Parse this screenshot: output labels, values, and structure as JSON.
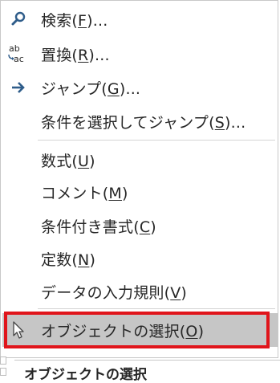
{
  "menu": {
    "items": [
      {
        "name": "find",
        "text": "検索(",
        "accel": "F",
        "tail": ")...",
        "icon": "search-icon"
      },
      {
        "name": "replace",
        "text": "置換(",
        "accel": "R",
        "tail": ")...",
        "icon": "replace-abc-icon",
        "icon_text_top": "ab",
        "icon_text_bottom": "ac"
      },
      {
        "name": "goto",
        "text": "ジャンプ(",
        "accel": "G",
        "tail": ")...",
        "icon": "arrow-right-icon"
      },
      {
        "name": "goto-special",
        "text": "条件を選択してジャンプ(",
        "accel": "S",
        "tail": ")..."
      },
      {
        "name": "formulas",
        "text": "数式(",
        "accel": "U",
        "tail": ")"
      },
      {
        "name": "comments",
        "text": "コメント(",
        "accel": "M",
        "tail": ")"
      },
      {
        "name": "conditional-formatting",
        "text": "条件付き書式(",
        "accel": "C",
        "tail": ")"
      },
      {
        "name": "constants",
        "text": "定数(",
        "accel": "N",
        "tail": ")"
      },
      {
        "name": "data-validation",
        "text": "データの入力規則(",
        "accel": "V",
        "tail": ")"
      },
      {
        "name": "select-objects",
        "text": "オブジェクトの選択(",
        "accel": "O",
        "tail": ")",
        "icon": "pointer-arrow-icon",
        "selected": true
      }
    ]
  },
  "tooltip": {
    "text": "オブジェクトの選択"
  },
  "colors": {
    "highlight_border": "#e0151b",
    "selected_background": "#c6c6c6",
    "icon_blue": "#2f5d8a"
  }
}
